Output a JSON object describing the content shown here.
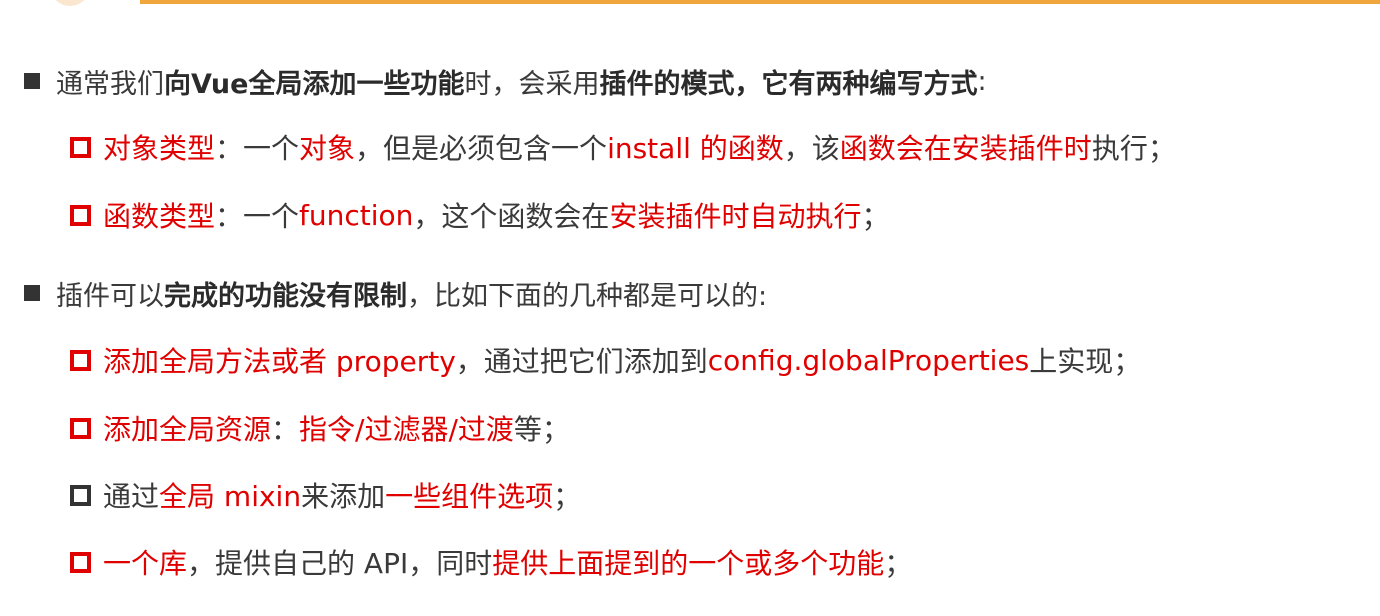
{
  "lines": [
    {
      "segments": [
        {
          "text": "通常我们",
          "style": "plain"
        },
        {
          "text": "向Vue全局添加一些功能",
          "style": "bold"
        },
        {
          "text": "时，会采用",
          "style": "plain"
        },
        {
          "text": "插件的模式，它有两种编写方式",
          "style": "bold"
        },
        {
          "text": ":",
          "style": "plain"
        }
      ]
    },
    {
      "segments": [
        {
          "text": "对象类型",
          "style": "red"
        },
        {
          "text": "：一个",
          "style": "plain"
        },
        {
          "text": "对象",
          "style": "red"
        },
        {
          "text": "，但是必须包含一个 ",
          "style": "plain"
        },
        {
          "text": "install 的函数",
          "style": "red"
        },
        {
          "text": "，该",
          "style": "plain"
        },
        {
          "text": "函数会在安装插件时",
          "style": "red"
        },
        {
          "text": "执行；",
          "style": "plain"
        }
      ]
    },
    {
      "segments": [
        {
          "text": "函数类型",
          "style": "red"
        },
        {
          "text": "：一个",
          "style": "plain"
        },
        {
          "text": "function",
          "style": "red"
        },
        {
          "text": "，这个函数会在",
          "style": "plain"
        },
        {
          "text": "安装插件时自动执行",
          "style": "red"
        },
        {
          "text": "；",
          "style": "plain"
        }
      ]
    },
    {
      "segments": [
        {
          "text": "插件可以",
          "style": "plain"
        },
        {
          "text": "完成的功能没有限制",
          "style": "bold"
        },
        {
          "text": "，比如下面的几种都是可以的:",
          "style": "plain"
        }
      ]
    },
    {
      "segments": [
        {
          "text": "添加全局方法或者 property",
          "style": "red"
        },
        {
          "text": "，通过把它们添加到 ",
          "style": "plain"
        },
        {
          "text": "config.globalProperties",
          "style": "red"
        },
        {
          "text": " 上实现；",
          "style": "plain"
        }
      ]
    },
    {
      "segments": [
        {
          "text": "添加全局资源",
          "style": "red"
        },
        {
          "text": "：",
          "style": "plain"
        },
        {
          "text": "指令/过滤器/过渡",
          "style": "red"
        },
        {
          "text": "等；",
          "style": "plain"
        }
      ]
    },
    {
      "segments": [
        {
          "text": "通过",
          "style": "plain"
        },
        {
          "text": "全局 mixin",
          "style": "red"
        },
        {
          "text": " 来添加",
          "style": "plain"
        },
        {
          "text": "一些组件选项",
          "style": "red"
        },
        {
          "text": "；",
          "style": "plain"
        }
      ]
    },
    {
      "segments": [
        {
          "text": "一个库",
          "style": "red"
        },
        {
          "text": "，提供自己的 API，同时",
          "style": "plain"
        },
        {
          "text": "提供上面提到的一个或多个功能",
          "style": "red"
        },
        {
          "text": "；",
          "style": "plain"
        }
      ]
    }
  ]
}
